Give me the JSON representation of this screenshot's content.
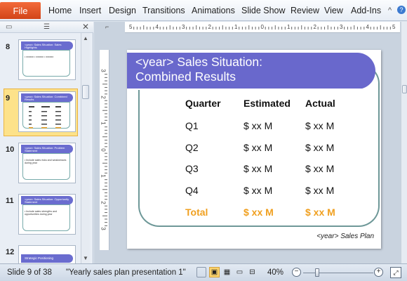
{
  "ribbon": {
    "file_label": "File",
    "tabs": [
      "Home",
      "Insert",
      "Design",
      "Transitions",
      "Animations",
      "Slide Show",
      "Review",
      "View",
      "Add-Ins"
    ],
    "controls": [
      "^",
      "?"
    ]
  },
  "slides_panel": {
    "thumbnails": [
      {
        "number": "8",
        "title": "<year> Sales Situation: Sales Highlights",
        "body": "• xxxxxx  • xxxxxx  • xxxxxx"
      },
      {
        "number": "9",
        "title": "<year> Sales Situation: Combined Results",
        "body": ""
      },
      {
        "number": "10",
        "title": "<year> Sales Situation: Problem Statement",
        "body": "• Include sales risks and weaknesses during year"
      },
      {
        "number": "11",
        "title": "<year> Sales Situation: Opportunity Statement",
        "body": "• Include sales strengths and opportunities during year"
      },
      {
        "number": "12",
        "title": "Strategic Positioning",
        "body": ""
      }
    ]
  },
  "ruler": {
    "h_marks": [
      "5",
      "4",
      "3",
      "2",
      "1",
      "0",
      "1",
      "2",
      "3",
      "4",
      "5"
    ],
    "v_marks": [
      "3",
      "2",
      "1",
      "0",
      "1",
      "2",
      "3"
    ]
  },
  "slide": {
    "title_line1": "<year> Sales Situation:",
    "title_line2": "Combined Results",
    "table": {
      "headers": [
        "Quarter",
        "Estimated",
        "Actual"
      ],
      "rows": [
        [
          "Q1",
          "$ xx M",
          "$ xx M"
        ],
        [
          "Q2",
          "$ xx M",
          "$ xx M"
        ],
        [
          "Q3",
          "$ xx M",
          "$ xx M"
        ],
        [
          "Q4",
          "$ xx M",
          "$ xx M"
        ]
      ],
      "total": [
        "Total",
        "$ xx M",
        "$ xx M"
      ]
    },
    "footer": "<year>  Sales Plan"
  },
  "status": {
    "slide_info": "Slide 9 of 38",
    "file_name": "\"Yearly sales plan presentation 1\"",
    "zoom": "40%",
    "zoom_level": 0.4,
    "minus": "−",
    "plus": "+"
  },
  "colors": {
    "title_bar": "#6968cc",
    "total_text": "#f0a020",
    "file_tab": "#e0501f",
    "selected_thumb": "#fde28a"
  }
}
